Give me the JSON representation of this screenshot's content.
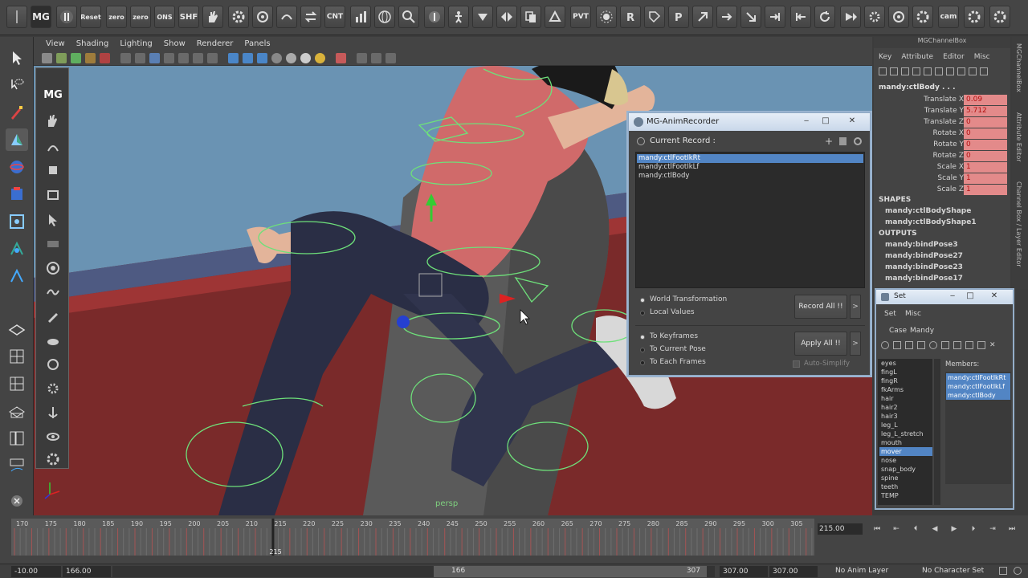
{
  "shelf": {
    "reset_label": "Reset",
    "zero_label": "zero",
    "zero2_label": "zero",
    "ons_label": "ONS",
    "shf_label": "SHF",
    "cnt_label": "CNT",
    "pvt_label": "PVT",
    "cam_label": "cam"
  },
  "viewport": {
    "menu": [
      "View",
      "Shading",
      "Lighting",
      "Show",
      "Renderer",
      "Panels"
    ],
    "camera_label": "persp"
  },
  "mgtools": {
    "label": "MG"
  },
  "channel_box": {
    "title": "MGChannelBox",
    "menu": [
      "Key",
      "Attribute",
      "Editor",
      "Misc"
    ],
    "object": "mandy:ctlBody . . .",
    "attributes": [
      {
        "label": "Translate X",
        "value": "0.09"
      },
      {
        "label": "Translate Y",
        "value": "5.712"
      },
      {
        "label": "Translate Z",
        "value": "0"
      },
      {
        "label": "Rotate X",
        "value": "0"
      },
      {
        "label": "Rotate Y",
        "value": "0"
      },
      {
        "label": "Rotate Z",
        "value": "0"
      },
      {
        "label": "Scale X",
        "value": "1"
      },
      {
        "label": "Scale Y",
        "value": "1"
      },
      {
        "label": "Scale Z",
        "value": "1"
      }
    ],
    "shapes_header": "SHAPES",
    "shapes": [
      "mandy:ctlBodyShape",
      "mandy:ctlBodyShape1"
    ],
    "outputs_header": "OUTPUTS",
    "outputs": [
      "mandy:bindPose3",
      "mandy:bindPose27",
      "mandy:bindPose23",
      "mandy:bindPose17"
    ],
    "side_tabs": [
      "MGChannelBox",
      "Attribute Editor",
      "Channel Box / Layer Editor"
    ]
  },
  "recorder": {
    "title": "MG-AnimRecorder",
    "current_record_label": "Current Record :",
    "records": [
      "mandy:ctlFootIkRt",
      "mandy:ctlFootIkLf",
      "mandy:ctlBody"
    ],
    "selected_index": 0,
    "space_options": [
      "World Transformation",
      "Local Values"
    ],
    "record_button": "Record All !!",
    "target_options": [
      "To Keyframes",
      "To Current Pose",
      "To Each Frames"
    ],
    "apply_button": "Apply All !!",
    "auto_simplify": "Auto-Simplify",
    "arrow": ">"
  },
  "setwin": {
    "title": "Set",
    "menu": [
      "Set",
      "Misc"
    ],
    "case_label": "Case",
    "case_value": "Mandy",
    "members_label": "Members:",
    "sets": [
      "eyes",
      "fingL",
      "fingR",
      "fkArms",
      "hair",
      "hair2",
      "hair3",
      "leg_L",
      "leg_L_stretch",
      "mouth",
      "mover",
      "nose",
      "snap_body",
      "spine",
      "teeth",
      "TEMP"
    ],
    "selected_set": "mover",
    "members": [
      "mandy:ctlFootIkRt",
      "mandy:ctlFootIkLf",
      "mandy:ctlBody"
    ]
  },
  "timeline": {
    "ticks": [
      "170",
      "175",
      "180",
      "185",
      "190",
      "195",
      "200",
      "205",
      "210",
      "215",
      "220",
      "225",
      "230",
      "235",
      "240",
      "245",
      "250",
      "255",
      "260",
      "265",
      "270",
      "275",
      "280",
      "285",
      "290",
      "295",
      "300",
      "305"
    ],
    "current_marker": "215",
    "current_frame": "215.00",
    "range_start": "-10.00",
    "range_inner_start": "166.00",
    "slider_start": "166",
    "slider_end": "307",
    "range_inner_end": "307.00",
    "range_end": "307.00",
    "anim_layer": "No Anim Layer",
    "char_set": "No Character Set"
  }
}
